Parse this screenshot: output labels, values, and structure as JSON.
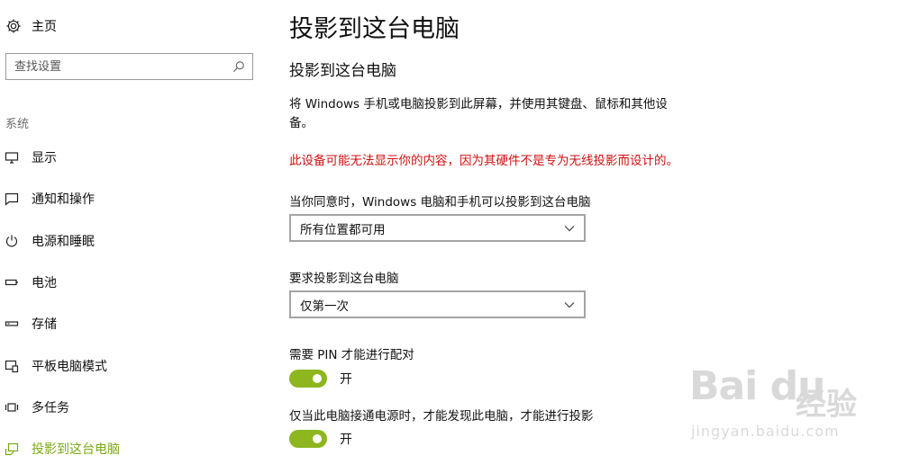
{
  "sidebar": {
    "home_label": "主页",
    "search_placeholder": "查找设置",
    "section_label": "系统",
    "items": [
      {
        "label": "显示",
        "icon": "display-icon"
      },
      {
        "label": "通知和操作",
        "icon": "notification-icon"
      },
      {
        "label": "电源和睡眠",
        "icon": "power-icon"
      },
      {
        "label": "电池",
        "icon": "battery-icon"
      },
      {
        "label": "存储",
        "icon": "storage-icon"
      },
      {
        "label": "平板电脑模式",
        "icon": "tablet-mode-icon"
      },
      {
        "label": "多任务",
        "icon": "multitasking-icon"
      },
      {
        "label": "投影到这台电脑",
        "icon": "project-icon",
        "active": true
      }
    ]
  },
  "main": {
    "page_title": "投影到这台电脑",
    "section_title": "投影到这台电脑",
    "description": "将 Windows 手机或电脑投影到此屏幕，并使用其键盘、鼠标和其他设备。",
    "warning": "此设备可能无法显示你的内容，因为其硬件不是专为无线投影而设计的。",
    "availability": {
      "label": "当你同意时，Windows 电脑和手机可以投影到这台电脑",
      "value": "所有位置都可用"
    },
    "ask": {
      "label": "要求投影到这台电脑",
      "value": "仅第一次"
    },
    "pin": {
      "label": "需要 PIN 才能进行配对",
      "state": "开",
      "on": true
    },
    "power": {
      "label": "仅当此电脑接通电源时，才能发现此电脑，才能进行投影",
      "state": "开",
      "on": true
    }
  },
  "watermark": {
    "logo": "Bai du",
    "name": "经验",
    "url": "jingyan.baidu.com"
  },
  "colors": {
    "accent": "#7aaa10",
    "toggle_on": "#8db61f",
    "warning": "#d01010"
  }
}
